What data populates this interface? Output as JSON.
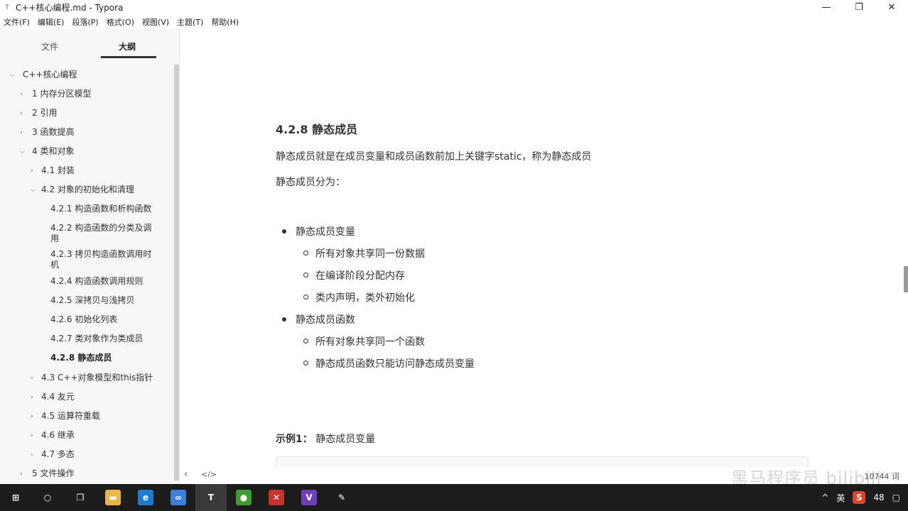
{
  "window": {
    "title": "C++核心编程.md - Typora",
    "app_icon": "T",
    "minimize": "—",
    "restore": "❐",
    "close": "✕"
  },
  "menu": [
    "文件(F)",
    "编辑(E)",
    "段落(P)",
    "格式(O)",
    "视图(V)",
    "主题(T)",
    "帮助(H)"
  ],
  "sidebar": {
    "tabs": {
      "files": "文件",
      "outline": "大纲"
    },
    "outline": [
      {
        "label": "C++核心编程",
        "toggle": "⌵"
      },
      {
        "label": "1 内存分区模型",
        "toggle": "›"
      },
      {
        "label": "2 引用",
        "toggle": "›"
      },
      {
        "label": "3 函数提高",
        "toggle": "›"
      },
      {
        "label": "4 类和对象",
        "toggle": "⌵"
      },
      {
        "label": "4.1 封装",
        "toggle": "›"
      },
      {
        "label": "4.2 对象的初始化和清理",
        "toggle": "⌵"
      },
      {
        "label": "4.2.1 构造函数和析构函数",
        "toggle": ""
      },
      {
        "label": "4.2.2 构造函数的分类及调用",
        "toggle": ""
      },
      {
        "label": "4.2.3 拷贝构造函数调用时机",
        "toggle": ""
      },
      {
        "label": "4.2.4 构造函数调用规则",
        "toggle": ""
      },
      {
        "label": "4.2.5 深拷贝与浅拷贝",
        "toggle": ""
      },
      {
        "label": "4.2.6 初始化列表",
        "toggle": ""
      },
      {
        "label": "4.2.7 类对象作为类成员",
        "toggle": ""
      },
      {
        "label": "4.2.8 静态成员",
        "toggle": ""
      },
      {
        "label": "4.3 C++对象模型和this指针",
        "toggle": "›"
      },
      {
        "label": "4.4 友元",
        "toggle": "›"
      },
      {
        "label": "4.5 运算符重载",
        "toggle": "›"
      },
      {
        "label": "4.6 继承",
        "toggle": "›"
      },
      {
        "label": "4.7 多态",
        "toggle": "›"
      },
      {
        "label": "5 文件操作",
        "toggle": "›"
      }
    ]
  },
  "content": {
    "heading": "4.2.8 静态成员",
    "intro": "静态成员就是在成员变量和成员函数前加上关键字static，称为静态成员",
    "classify": "静态成员分为：",
    "list": [
      {
        "label": "静态成员变量",
        "sub": [
          "所有对象共享同一份数据",
          "在编译阶段分配内存",
          "类内声明，类外初始化"
        ]
      },
      {
        "label": "静态成员函数",
        "sub": [
          "所有对象共享同一个函数",
          "静态成员函数只能访问静态成员变量"
        ]
      }
    ],
    "example_label": "示例1：",
    "example_title": " 静态成员变量"
  },
  "status": {
    "collapse": "‹",
    "source_mode": "</>",
    "word_count": "10744 词",
    "watermark": "黑马程序员 bilibili"
  },
  "taskbar": {
    "tray_ime": "英",
    "tray_up": "^",
    "tray_badge": "S",
    "tray_count": "48",
    "apps": [
      {
        "name": "start",
        "glyph": "⊞",
        "color": "#1c1c1c"
      },
      {
        "name": "search",
        "glyph": "○",
        "color": "#1c1c1c"
      },
      {
        "name": "task-view",
        "glyph": "❐",
        "color": "#1c1c1c"
      },
      {
        "name": "file-explorer",
        "glyph": "▬",
        "color": "#e8b64a"
      },
      {
        "name": "edge",
        "glyph": "e",
        "color": "#1f7ad1"
      },
      {
        "name": "baidu-netdisk",
        "glyph": "∞",
        "color": "#3d7fe0"
      },
      {
        "name": "typora",
        "glyph": "T",
        "color": "#3a3a3a"
      },
      {
        "name": "green-app",
        "glyph": "●",
        "color": "#3e9b2e"
      },
      {
        "name": "xmind",
        "glyph": "✕",
        "color": "#c8332c"
      },
      {
        "name": "visual-studio",
        "glyph": "V",
        "color": "#6f3fb5"
      },
      {
        "name": "paint-app",
        "glyph": "✎",
        "color": "#1c1c1c"
      }
    ]
  }
}
